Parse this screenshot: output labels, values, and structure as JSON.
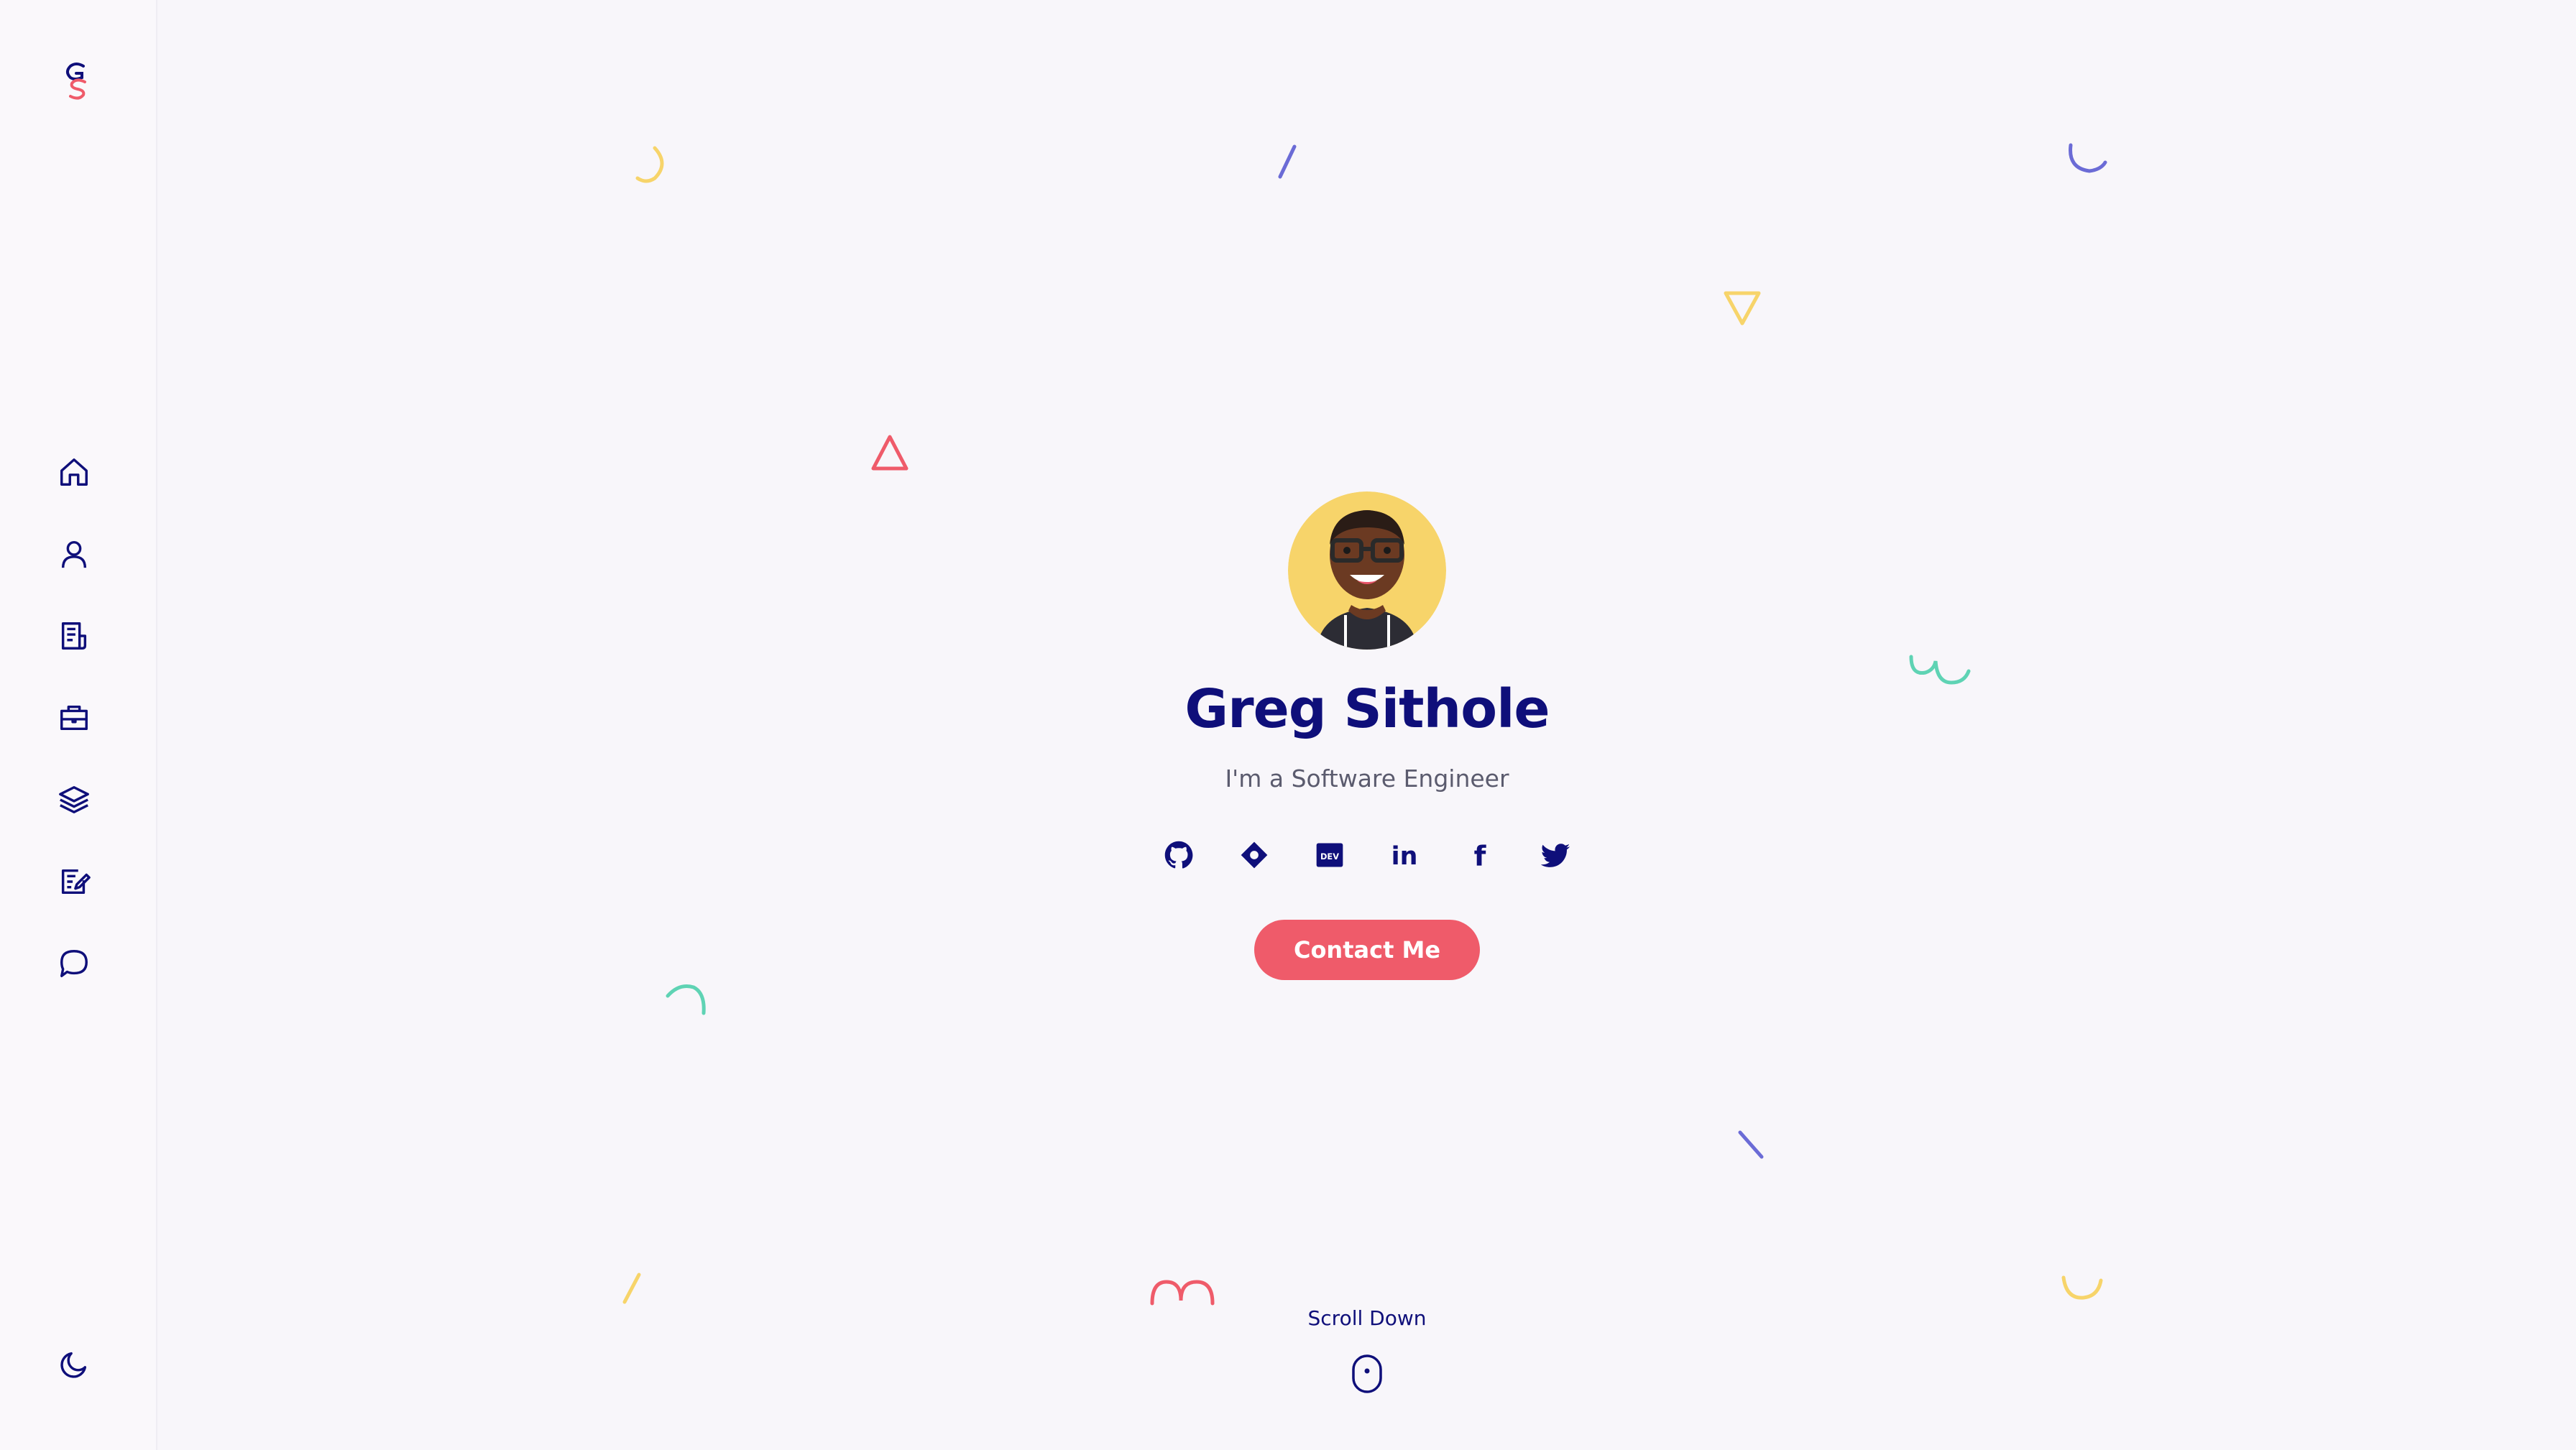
{
  "brand": {
    "logo_icon": "gs-monogram-logo",
    "colors": {
      "navy": "#0f0f7a",
      "coral": "#ef5b6a",
      "yellow": "#f7d46a",
      "teal": "#5fd3b4",
      "purple": "#6b6bd6",
      "background": "#f8f6fa"
    }
  },
  "sidebar": {
    "items": [
      {
        "id": "home",
        "icon": "home-icon"
      },
      {
        "id": "about",
        "icon": "user-icon"
      },
      {
        "id": "resume",
        "icon": "document-icon"
      },
      {
        "id": "portfolio",
        "icon": "briefcase-icon"
      },
      {
        "id": "skills",
        "icon": "layers-icon"
      },
      {
        "id": "blog",
        "icon": "edit-note-icon"
      },
      {
        "id": "contact",
        "icon": "chat-bubble-icon"
      }
    ],
    "theme_toggle_icon": "moon-icon"
  },
  "hero": {
    "name": "Greg Sithole",
    "subtitle": "I'm a Software Engineer",
    "avatar": "avatar-illustration",
    "socials": [
      {
        "id": "github",
        "icon": "github-icon"
      },
      {
        "id": "codepen",
        "icon": "diamond-icon"
      },
      {
        "id": "dev",
        "icon": "dev-icon",
        "label": "DEV"
      },
      {
        "id": "linkedin",
        "icon": "linkedin-icon",
        "label": "in"
      },
      {
        "id": "facebook",
        "icon": "facebook-icon",
        "label": "f"
      },
      {
        "id": "twitter",
        "icon": "twitter-icon"
      }
    ],
    "cta_label": "Contact Me",
    "scroll_label": "Scroll Down",
    "scroll_icon": "mouse-icon"
  }
}
